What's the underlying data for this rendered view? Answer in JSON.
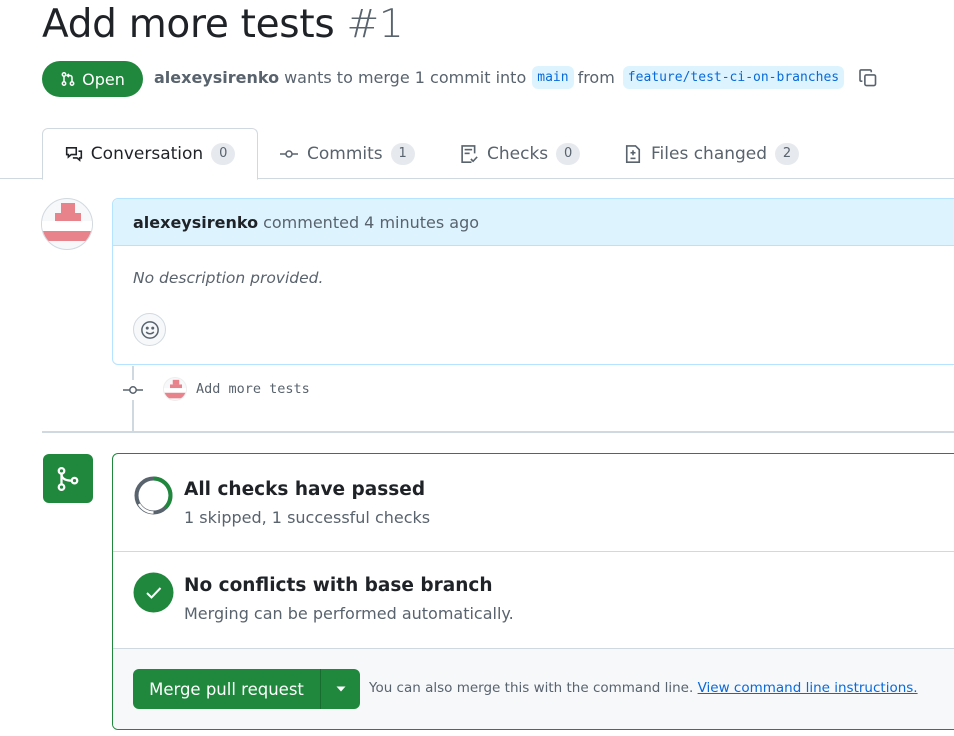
{
  "pr": {
    "title": "Add more tests",
    "number": "#1",
    "state": "Open",
    "author": "alexeysirenko",
    "meta_text": "wants to merge 1 commit into",
    "base_branch": "main",
    "from_text": "from",
    "head_branch": "feature/test-ci-on-branches"
  },
  "tabs": [
    {
      "label": "Conversation",
      "count": "0"
    },
    {
      "label": "Commits",
      "count": "1"
    },
    {
      "label": "Checks",
      "count": "0"
    },
    {
      "label": "Files changed",
      "count": "2"
    }
  ],
  "comment": {
    "author": "alexeysirenko",
    "action": "commented 4 minutes ago",
    "body": "No description provided."
  },
  "commit": {
    "message": "Add more tests"
  },
  "merge": {
    "checks_title": "All checks have passed",
    "checks_sub": "1 skipped, 1 successful checks",
    "conflicts_title": "No conflicts with base branch",
    "conflicts_sub": "Merging can be performed automatically.",
    "button_label": "Merge pull request",
    "cli_note": "You can also merge this with the command line.",
    "cli_link": "View command line instructions."
  },
  "colors": {
    "green": "#1f883d",
    "blue": "#0969da",
    "blue_bg": "#ddf4ff",
    "muted": "#59636e"
  },
  "icons": [
    "git-pull-request-icon",
    "copy-icon",
    "comment-discussion-icon",
    "git-commit-icon",
    "checklist-icon",
    "file-diff-icon",
    "smiley-icon",
    "git-merge-icon",
    "check-circle-icon",
    "triangle-down-icon"
  ]
}
